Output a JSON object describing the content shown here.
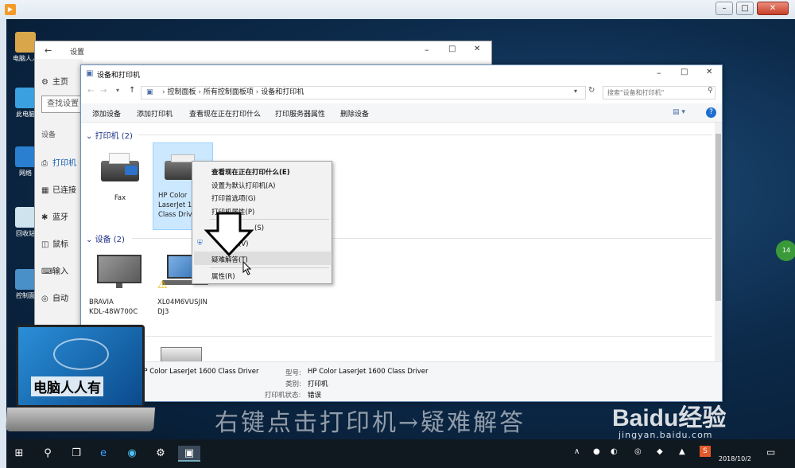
{
  "desktop": {
    "icons": [
      {
        "label": "电脑人人"
      },
      {
        "label": "此电脑"
      },
      {
        "label": "网络"
      },
      {
        "label": "回收站"
      },
      {
        "label": "控制面"
      }
    ]
  },
  "settings": {
    "title": "设置",
    "home": "主页",
    "search_placeholder": "查找设置",
    "section": "设备",
    "items": [
      "打印机",
      "已连接",
      "蓝牙",
      "鼠标",
      "输入",
      "自动"
    ]
  },
  "devices_window": {
    "title": "设备和打印机",
    "breadcrumb": [
      "控制面板",
      "所有控制面板项",
      "设备和打印机"
    ],
    "search_placeholder": "搜索\"设备和打印机\"",
    "toolbar": [
      "添加设备",
      "添加打印机",
      "查看现在正在打印什么",
      "打印服务器属性",
      "删除设备"
    ],
    "printers_group": "打印机 (2)",
    "devices_group": "设备 (2)",
    "printers": [
      {
        "name": "Fax"
      },
      {
        "name_lines": [
          "HP Color",
          "LaserJet 1",
          "Class Driv"
        ]
      }
    ],
    "devices": [
      {
        "name_lines": [
          "BRAVIA",
          "KDL-48W700C"
        ]
      },
      {
        "name_lines": [
          "XL04M6VUSJIN",
          "DJ3"
        ]
      }
    ],
    "details": {
      "device_name": "HP Color LaserJet 1600 Class Driver",
      "model_label": "型号:",
      "model_value": "HP Color LaserJet 1600 Class Driver",
      "category_label": "类别:",
      "category_value": "打印机",
      "status_label": "打印机状态:",
      "status_value": "错误"
    }
  },
  "context_menu": {
    "items": [
      "查看现在正在打印什么(E)",
      "设置为默认打印机(A)",
      "打印首选项(G)",
      "打印机属性(P)",
      "(S)",
      "(V)",
      "疑难解答(T)",
      "属性(R)"
    ]
  },
  "overlay": {
    "laptop_text": "电脑人人有",
    "caption": "右键点击打印机→疑难解答",
    "watermark": "Baidu经验",
    "watermark_url": "jingyan.baidu.com"
  },
  "taskbar": {
    "date": "2018/10/2",
    "side_badge": "14"
  }
}
